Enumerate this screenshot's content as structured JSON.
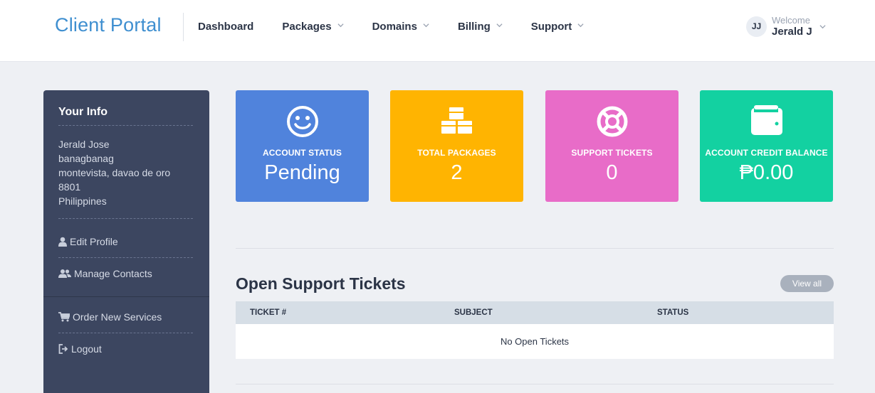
{
  "brand": "Client Portal",
  "nav": [
    {
      "label": "Dashboard",
      "dropdown": false
    },
    {
      "label": "Packages",
      "dropdown": true
    },
    {
      "label": "Domains",
      "dropdown": true
    },
    {
      "label": "Billing",
      "dropdown": true
    },
    {
      "label": "Support",
      "dropdown": true
    }
  ],
  "user": {
    "initials": "JJ",
    "welcome": "Welcome",
    "name": "Jerald J"
  },
  "sidebar": {
    "title": "Your Info",
    "info": [
      "Jerald Jose",
      "banagbanag",
      "montevista, davao de oro",
      "8801",
      "Philippines"
    ],
    "links": [
      {
        "label": "Edit Profile",
        "icon": "user-icon"
      },
      {
        "label": "Manage Contacts",
        "icon": "users-icon"
      },
      {
        "label": "Order New Services",
        "icon": "cart-icon"
      },
      {
        "label": "Logout",
        "icon": "logout-icon"
      }
    ]
  },
  "tiles": [
    {
      "label": "ACCOUNT STATUS",
      "value": "Pending",
      "icon": "smile-icon",
      "color": "#5083dc"
    },
    {
      "label": "TOTAL PACKAGES",
      "value": "2",
      "icon": "boxes-icon",
      "color": "#ffb401"
    },
    {
      "label": "SUPPORT TICKETS",
      "value": "0",
      "icon": "life-ring-icon",
      "color": "#e86cc8"
    },
    {
      "label": "ACCOUNT CREDIT BALANCE",
      "value": "₱0.00",
      "icon": "wallet-icon",
      "color": "#13d1a1"
    }
  ],
  "tickets": {
    "title": "Open Support Tickets",
    "view_all": "View all",
    "columns": [
      "TICKET #",
      "SUBJECT",
      "STATUS"
    ],
    "empty_text": "No Open Tickets"
  }
}
